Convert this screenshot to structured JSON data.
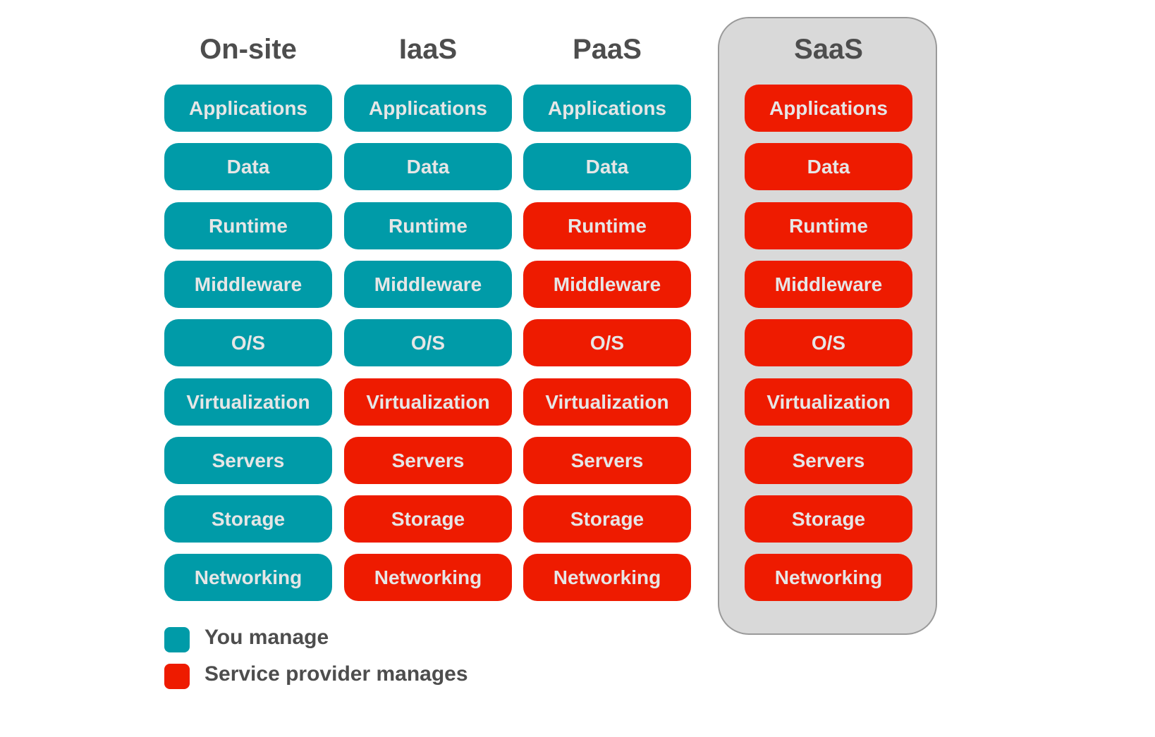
{
  "colors": {
    "you_manage": "#009ba8",
    "provider_manages": "#ee1b00",
    "highlight_panel": "#d9d9d9"
  },
  "highlighted_column": "SaaS",
  "layers": [
    "Applications",
    "Data",
    "Runtime",
    "Middleware",
    "O/S",
    "Virtualization",
    "Servers",
    "Storage",
    "Networking"
  ],
  "columns": [
    {
      "title": "On-site",
      "managed_by": [
        "you",
        "you",
        "you",
        "you",
        "you",
        "you",
        "you",
        "you",
        "you"
      ]
    },
    {
      "title": "IaaS",
      "managed_by": [
        "you",
        "you",
        "you",
        "you",
        "you",
        "provider",
        "provider",
        "provider",
        "provider"
      ]
    },
    {
      "title": "PaaS",
      "managed_by": [
        "you",
        "you",
        "provider",
        "provider",
        "provider",
        "provider",
        "provider",
        "provider",
        "provider"
      ]
    },
    {
      "title": "SaaS",
      "managed_by": [
        "provider",
        "provider",
        "provider",
        "provider",
        "provider",
        "provider",
        "provider",
        "provider",
        "provider"
      ]
    }
  ],
  "legend": [
    {
      "key": "you",
      "label": "You manage"
    },
    {
      "key": "provider",
      "label": "Service provider manages"
    }
  ]
}
